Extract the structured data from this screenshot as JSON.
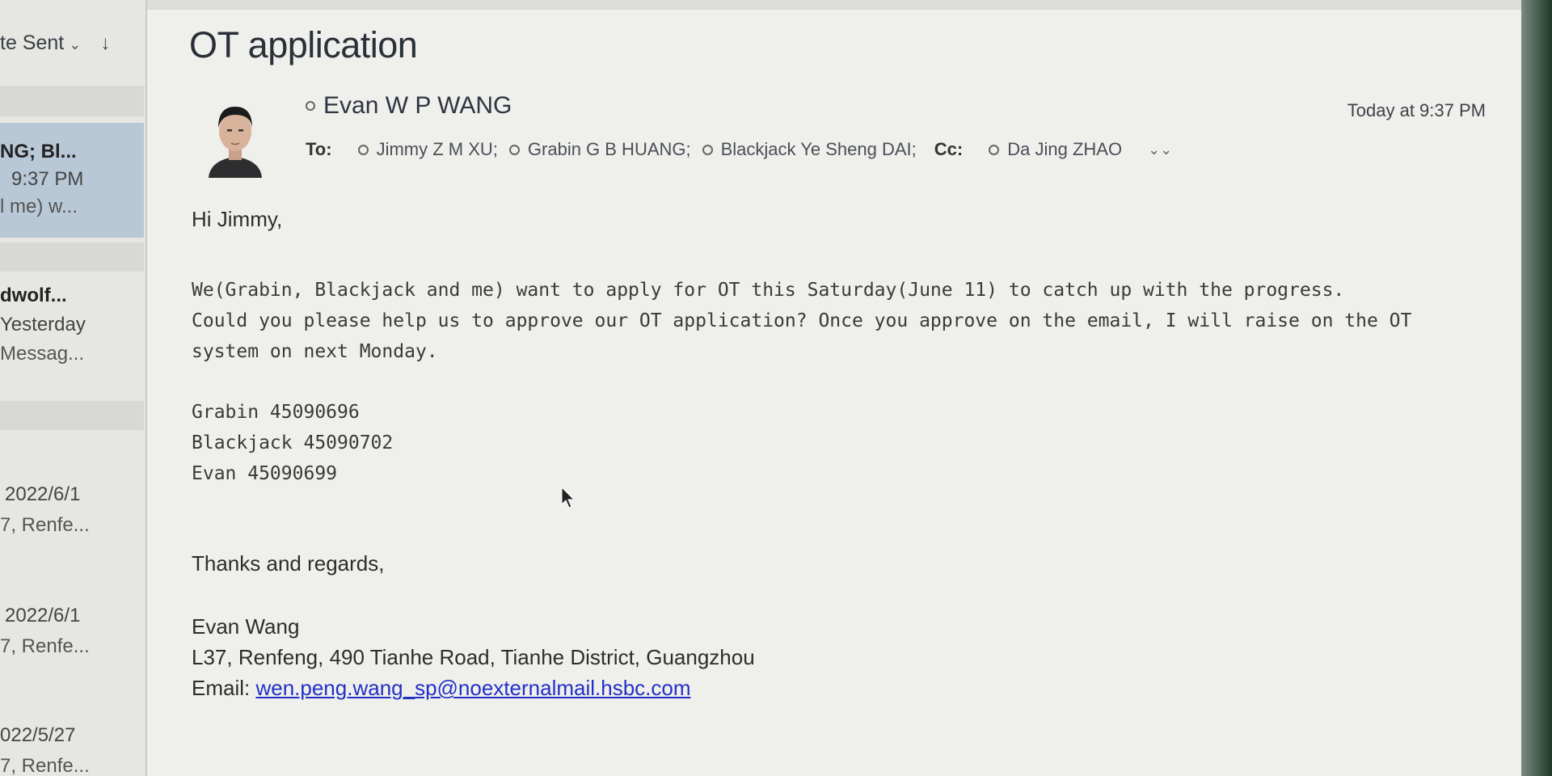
{
  "message_list": {
    "sort_label": "te Sent",
    "items": [
      {
        "sender": "NG; Bl...",
        "time": "9:37 PM",
        "snippet": "l me) w...",
        "selected": true
      },
      {
        "sender": "dwolf...",
        "time": "Yesterday",
        "snippet": "Messag...",
        "selected": false
      },
      {
        "sender": "",
        "time": "2022/6/1",
        "snippet": "7, Renfe...",
        "selected": false
      },
      {
        "sender": "",
        "time": "2022/6/1",
        "snippet": "7, Renfe...",
        "selected": false
      },
      {
        "sender": "",
        "time": "022/5/27",
        "snippet": "7, Renfe...",
        "selected": false
      }
    ]
  },
  "email": {
    "subject": "OT application",
    "from": "Evan W P WANG",
    "date": "Today at 9:37 PM",
    "to_label": "To:",
    "to": [
      "Jimmy Z M XU;",
      "Grabin G B HUANG;",
      "Blackjack Ye Sheng DAI;"
    ],
    "cc_label": "Cc:",
    "cc": [
      "Da Jing ZHAO"
    ],
    "greeting": "Hi Jimmy,",
    "body_lines": [
      "We(Grabin, Blackjack and me) want to apply for OT this Saturday(June 11) to catch up with the progress.",
      "Could you please help us to approve our OT application? Once you approve on the email, I will raise on the OT",
      "system on next Monday."
    ],
    "codes": [
      "Grabin 45090696",
      "Blackjack 45090702",
      "Evan 45090699"
    ],
    "closing": "Thanks and regards,",
    "signature": {
      "name": "Evan Wang",
      "address": "L37, Renfeng, 490 Tianhe Road, Tianhe District, Guangzhou",
      "email_label": "Email: ",
      "email": "wen.peng.wang_sp@noexternalmail.hsbc.com"
    }
  },
  "colors": {
    "selected_row": "#b8c8d6",
    "link": "#2230c8"
  }
}
